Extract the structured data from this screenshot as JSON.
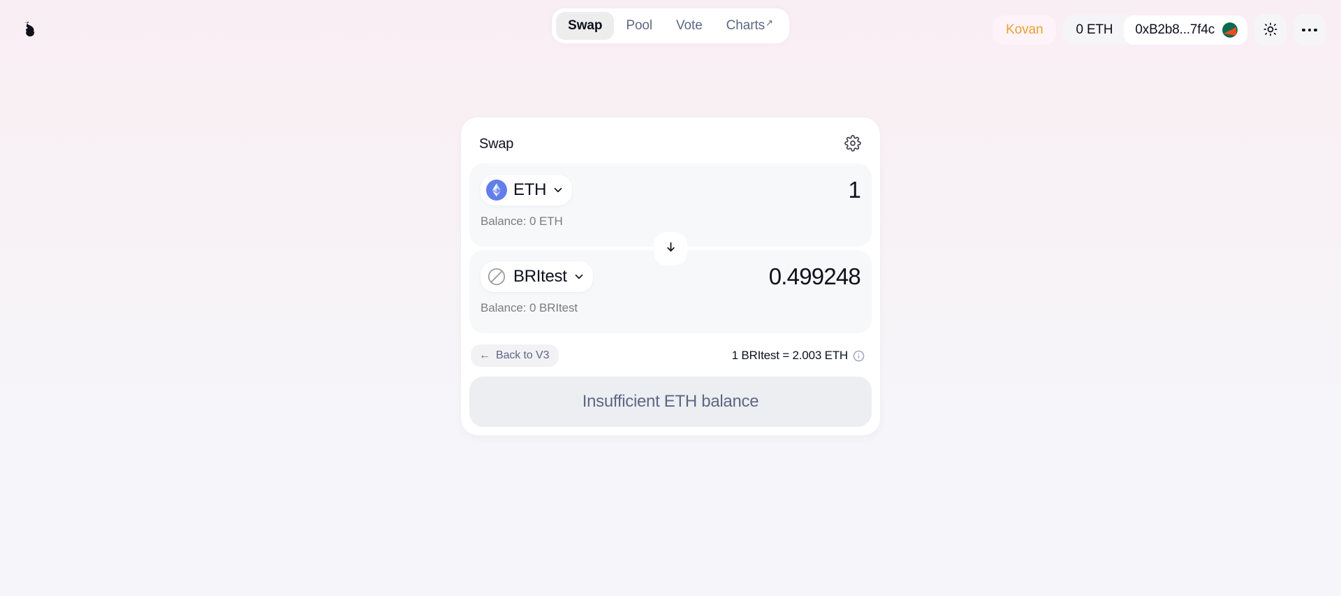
{
  "brand": {
    "logo_icon": "uniswap-unicorn-logo"
  },
  "nav": {
    "tabs": [
      {
        "label": "Swap",
        "active": true,
        "external": false
      },
      {
        "label": "Pool",
        "active": false,
        "external": false
      },
      {
        "label": "Vote",
        "active": false,
        "external": false
      },
      {
        "label": "Charts",
        "active": false,
        "external": true,
        "external_glyph": "↗"
      }
    ]
  },
  "header": {
    "network": "Kovan",
    "eth_balance": "0 ETH",
    "account_address": "0xB2b8...7f4c",
    "avatar_icon": "jazzicon-avatar",
    "theme_toggle_icon": "sun-icon",
    "more_menu_icon": "more-horizontal-icon",
    "network_color": "#eaa033"
  },
  "swap": {
    "title": "Swap",
    "settings_icon": "gear-icon",
    "toggle_direction_icon": "arrow-down-icon",
    "from": {
      "token_symbol": "ETH",
      "token_logo_icon": "ethereum-token-icon",
      "chevron_icon": "chevron-down-icon",
      "amount": "1",
      "amount_placeholder": "0.0",
      "balance": "Balance: 0 ETH"
    },
    "to": {
      "token_symbol": "BRItest",
      "token_logo_icon": "unknown-token-icon",
      "chevron_icon": "chevron-down-icon",
      "amount": "0.499248",
      "amount_placeholder": "0.0",
      "balance": "Balance: 0 BRItest"
    },
    "back_link": {
      "label": "Back to V3",
      "arrow_glyph": "←"
    },
    "price": {
      "text": "1 BRItest = 2.003 ETH",
      "info_icon": "info-circle-icon"
    },
    "action_button": {
      "label": "Insufficient ETH balance",
      "disabled": true
    }
  }
}
